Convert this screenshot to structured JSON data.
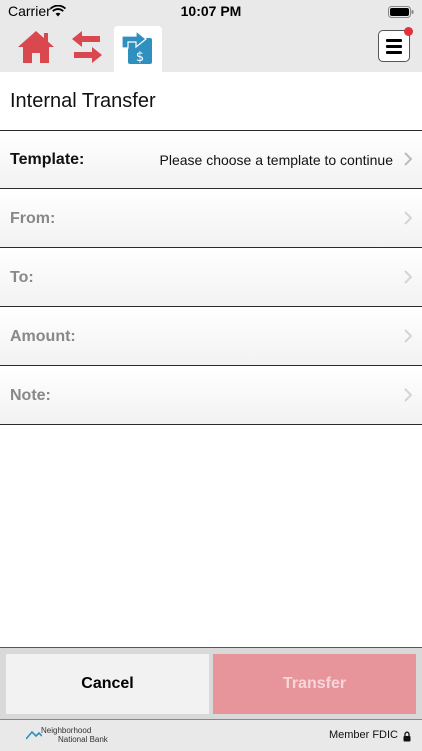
{
  "status_bar": {
    "carrier": "Carrier",
    "time": "10:07 PM"
  },
  "nav": {
    "tabs": [
      {
        "icon": "home-icon",
        "color": "#d9474f"
      },
      {
        "icon": "transfer-arrows-icon",
        "color": "#d9474f"
      },
      {
        "icon": "internal-transfer-icon",
        "color": "#2f8fbf",
        "active": true
      }
    ],
    "menu_icon": "hamburger-menu-icon",
    "badge_color": "#e0323c"
  },
  "page": {
    "title": "Internal Transfer"
  },
  "form": {
    "rows": [
      {
        "label": "Template:",
        "value": "Please choose a template to continue"
      },
      {
        "label": "From:",
        "value": ""
      },
      {
        "label": "To:",
        "value": ""
      },
      {
        "label": "Amount:",
        "value": ""
      },
      {
        "label": "Note:",
        "value": ""
      }
    ]
  },
  "actions": {
    "cancel_label": "Cancel",
    "transfer_label": "Transfer",
    "transfer_color": "#e7959a"
  },
  "footer": {
    "bank_name_line1": "Neighborhood",
    "bank_name_line2": "National Bank",
    "member_text": "Member FDIC"
  }
}
